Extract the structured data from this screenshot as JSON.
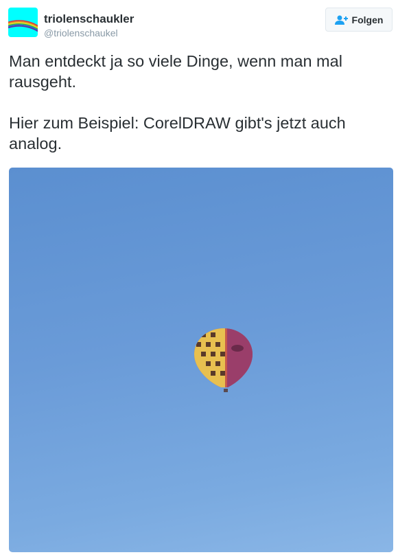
{
  "user": {
    "name": "triolenschaukler",
    "handle": "@triolenschaukel"
  },
  "follow_button": {
    "label": "Folgen",
    "icon": "person-plus-icon"
  },
  "tweet": {
    "paragraphs": [
      "Man entdeckt ja so viele Dinge, wenn man mal rausgeht.",
      "Hier zum Beispiel: CorelDRAW gibt's jetzt auch analog."
    ]
  },
  "colors": {
    "accent": "#1da1f2",
    "text": "#292f33",
    "muted": "#8899a6"
  }
}
